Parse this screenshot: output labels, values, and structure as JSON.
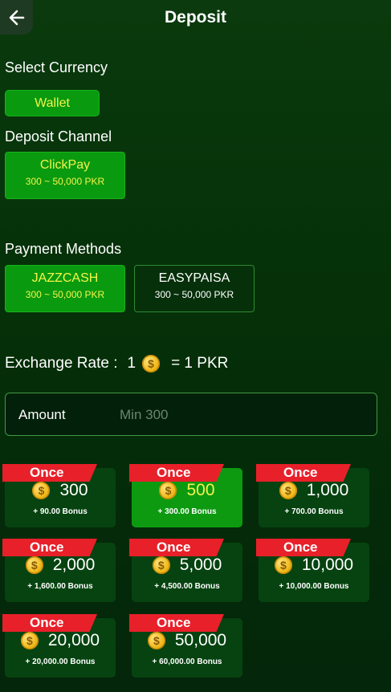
{
  "header": {
    "title": "Deposit"
  },
  "select_currency": {
    "label": "Select Currency",
    "wallet_label": "Wallet"
  },
  "deposit_channel": {
    "label": "Deposit Channel",
    "name": "ClickPay",
    "range": "300 ~ 50,000 PKR"
  },
  "payment_methods": {
    "label": "Payment Methods",
    "items": [
      {
        "name": "JAZZCASH",
        "range": "300 ~ 50,000 PKR",
        "active": true
      },
      {
        "name": "EASYPAISA",
        "range": "300 ~ 50,000 PKR",
        "active": false
      }
    ]
  },
  "exchange_rate": {
    "label": "Exchange Rate :",
    "left": "1",
    "right": "= 1 PKR"
  },
  "amount": {
    "label": "Amount",
    "placeholder": "Min 300"
  },
  "packages": {
    "items": [
      {
        "tag": "Once",
        "amount": "300",
        "bonus": "+ 90.00 Bonus",
        "selected": false
      },
      {
        "tag": "Once",
        "amount": "500",
        "bonus": "+ 300.00 Bonus",
        "selected": true
      },
      {
        "tag": "Once",
        "amount": "1,000",
        "bonus": "+ 700.00 Bonus",
        "selected": false
      },
      {
        "tag": "Once",
        "amount": "2,000",
        "bonus": "+ 1,600.00 Bonus",
        "selected": false
      },
      {
        "tag": "Once",
        "amount": "5,000",
        "bonus": "+ 4,500.00 Bonus",
        "selected": false
      },
      {
        "tag": "Once",
        "amount": "10,000",
        "bonus": "+ 10,000.00 Bonus",
        "selected": false
      },
      {
        "tag": "Once",
        "amount": "20,000",
        "bonus": "+ 20,000.00 Bonus",
        "selected": false
      },
      {
        "tag": "Once",
        "amount": "50,000",
        "bonus": "+ 60,000.00 Bonus",
        "selected": false
      }
    ]
  },
  "colors": {
    "accent_green": "#0a9a0f",
    "highlight_yellow": "#f4f44a",
    "ribbon_red": "#e8202a",
    "card_bg": "#064310"
  },
  "icons": {
    "back": "arrow-left-icon",
    "coin": "coin-icon"
  }
}
